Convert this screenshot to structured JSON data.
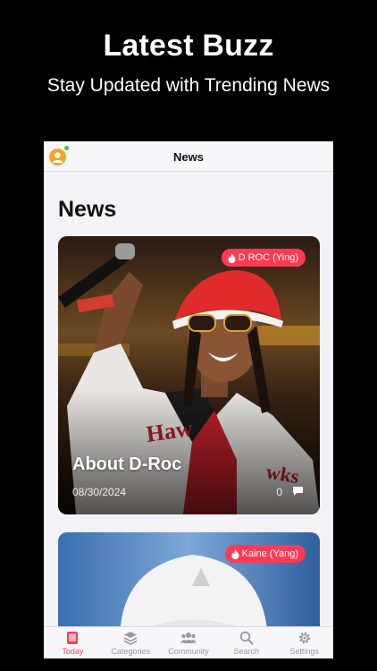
{
  "promo": {
    "title": "Latest Buzz",
    "subtitle": "Stay Updated with Trending News"
  },
  "nav": {
    "title": "News"
  },
  "page": {
    "heading": "News"
  },
  "articles": [
    {
      "tag": "D ROC (Ying)",
      "title": "About D-Roc",
      "date": "08/30/2024",
      "comments": "0"
    },
    {
      "tag": "Kaine (Yang)"
    }
  ],
  "tabs": [
    {
      "label": "Today",
      "icon": "today-icon",
      "active": true
    },
    {
      "label": "Categories",
      "icon": "stack-icon",
      "active": false
    },
    {
      "label": "Community",
      "icon": "people-icon",
      "active": false
    },
    {
      "label": "Search",
      "icon": "search-icon",
      "active": false
    },
    {
      "label": "Settings",
      "icon": "gear-icon",
      "active": false
    }
  ],
  "colors": {
    "accent": "#ff3b53",
    "background": "#000000",
    "screen": "#f2f2f7",
    "online": "#2ecc40"
  }
}
